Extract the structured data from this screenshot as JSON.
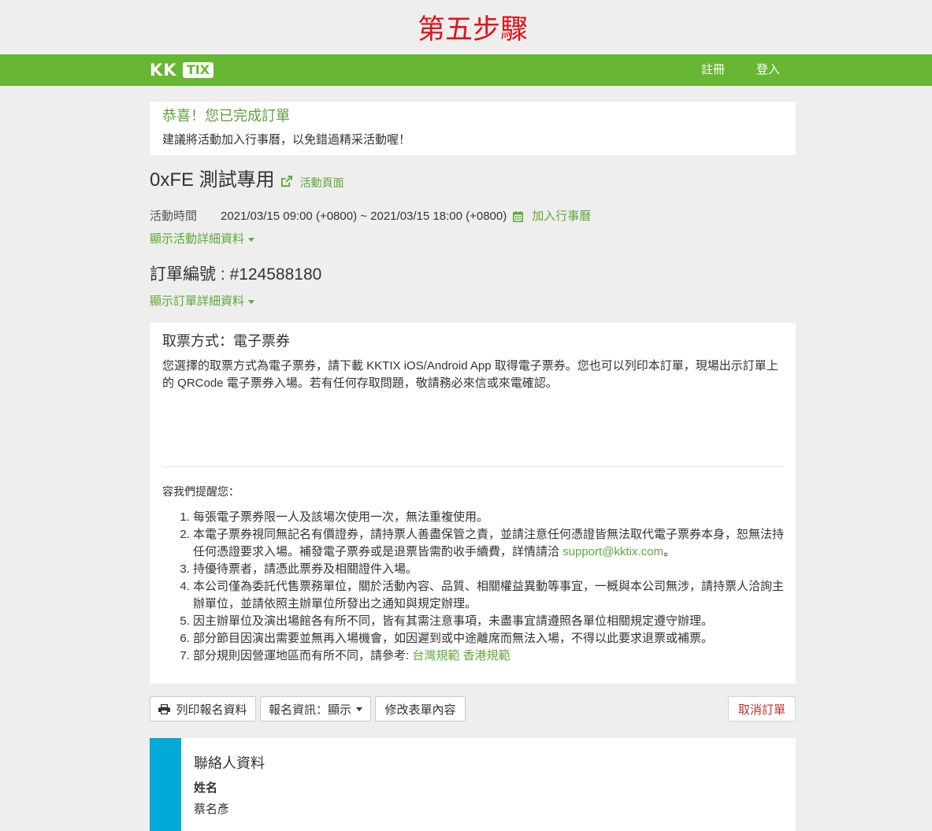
{
  "page_heading": "第五步驟",
  "colors": {
    "heading_red": "#e2131a",
    "brand_green": "#67b733",
    "link_green": "#5ea83a",
    "success_green": "#5f9f3c",
    "cancel_red": "#c9302c",
    "contact_accent": "#00a9d6"
  },
  "navbar": {
    "logo": {
      "kk": "KK",
      "tix": "TIX"
    },
    "links": [
      {
        "label": "註冊"
      },
      {
        "label": "登入"
      }
    ]
  },
  "order_complete_notice": {
    "title": "恭喜！您已完成訂單",
    "message": "建議將活動加入行事曆，以免錯過精采活動喔！"
  },
  "event": {
    "title": "0xFE 測試專用",
    "page_link": {
      "label": "活動頁面",
      "icon": "external-link-icon"
    },
    "time": {
      "label": "活動時間",
      "value": "2021/03/15 09:00 (+0800) ~ 2021/03/15 18:00 (+0800)",
      "add_to_calendar": {
        "label": "加入行事曆",
        "icon": "calendar-icon"
      }
    },
    "details_toggle": "顯示活動詳細資料"
  },
  "order": {
    "number_label": "訂單編號 :",
    "number": "#124588180",
    "details_toggle": "顯示訂單詳細資料"
  },
  "ticket": {
    "method_title": "取票方式：電子票券",
    "description": "您選擇的取票方式為電子票券，請下載 KKTIX iOS/Android App 取得電子票券。您也可以列印本訂單，現場出示訂單上的 QRCode 電子票券入場。若有任何存取問題，敬請務必來信或來電確認。",
    "reminder_title": "容我們提醒您：",
    "reminders": [
      {
        "text": "每張電子票券限一人及該場次使用一次，無法重複使用。"
      },
      {
        "text": "本電子票券視同無記名有價證券，請持票人善盡保管之責，並請注意任何憑證皆無法取代電子票券本身，恕無法持任何憑證要求入場。補發電子票券或是退票皆需酌收手續費，詳情請洽 ",
        "link": "support@kktix.com",
        "after": "。"
      },
      {
        "text": "持優待票者，請憑此票券及相關證件入場。"
      },
      {
        "text": "本公司僅為委託代售票務單位，關於活動內容、品質、相關權益異動等事宜，一概與本公司無涉，請持票人洽詢主辦單位，並請依照主辦單位所發出之通知與規定辦理。"
      },
      {
        "text": "因主辦單位及演出場館各有所不同，皆有其需注意事項，未盡事宜請遵照各單位相關規定遵守辦理。"
      },
      {
        "text": "部分節目因演出需要並無再入場機會，如因遲到或中途離席而無法入場，不得以此要求退票或補票。"
      },
      {
        "text": "部分規則因營運地區而有所不同，請參考: ",
        "links": [
          "台灣規範",
          "香港規範"
        ]
      }
    ]
  },
  "actions": {
    "print": {
      "label": "列印報名資料",
      "icon": "printer-icon"
    },
    "registration_info": {
      "label": "報名資訊：顯示"
    },
    "edit_form": {
      "label": "修改表單內容"
    },
    "cancel_order": {
      "label": "取消訂單"
    }
  },
  "contact": {
    "title": "聯絡人資料",
    "fields": [
      {
        "label": "姓名",
        "value": "蔡名彥"
      }
    ]
  }
}
